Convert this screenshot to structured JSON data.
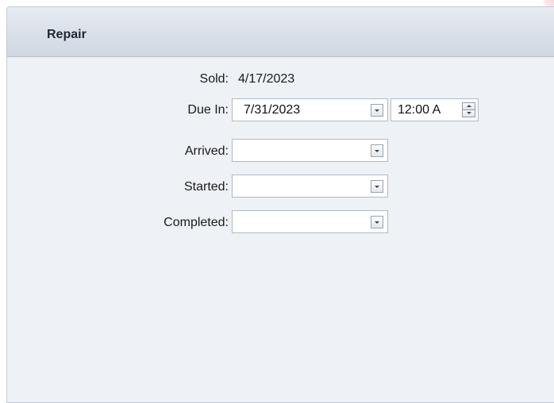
{
  "panel": {
    "title": "Repair"
  },
  "fields": {
    "sold": {
      "label": "Sold:",
      "value": "4/17/2023"
    },
    "due_in": {
      "label": "Due In:",
      "date": "7/31/2023",
      "time": "12:00 A"
    },
    "arrived": {
      "label": "Arrived:",
      "value": ""
    },
    "started": {
      "label": "Started:",
      "value": ""
    },
    "completed": {
      "label": "Completed:",
      "value": ""
    }
  },
  "icons": {
    "dropdown": "chevron-down-icon",
    "spinner_up": "spin-up-icon",
    "spinner_down": "spin-down-icon"
  },
  "colors": {
    "panel_bg": "#eef1f5",
    "header_bg": "#d9e0e8",
    "border": "#c5cbd3",
    "text": "#1a1a1a"
  }
}
